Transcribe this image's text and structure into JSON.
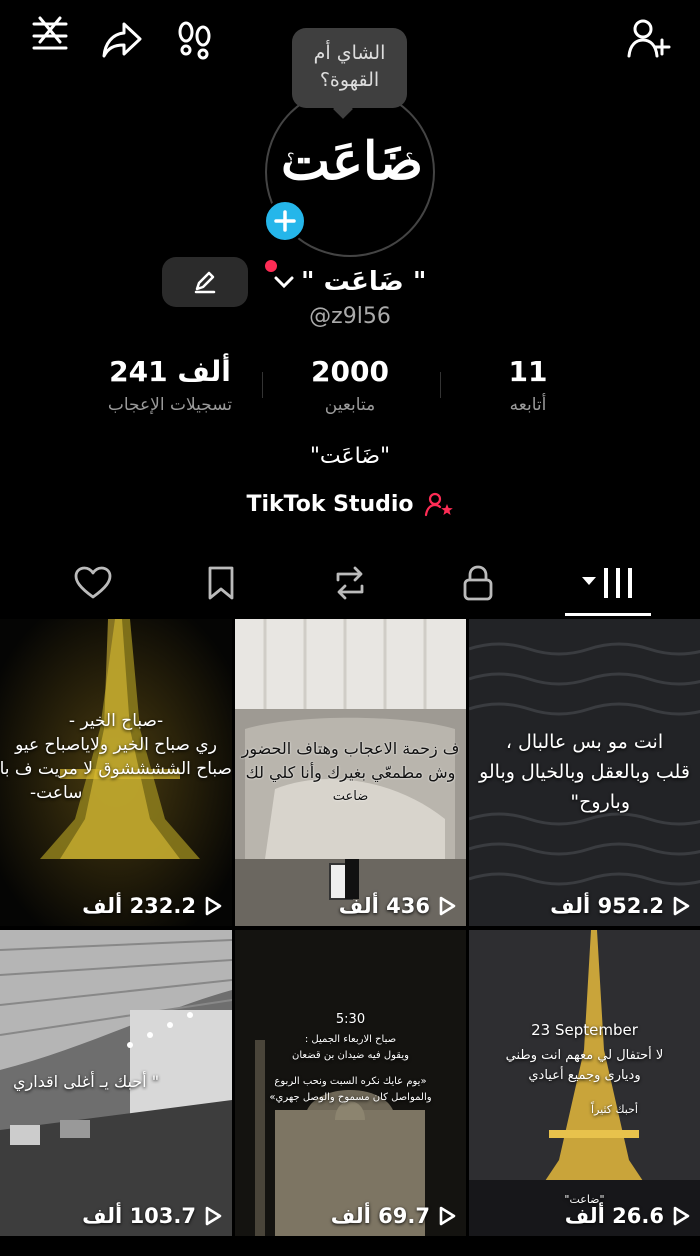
{
  "profile": {
    "note": "الشاي أم القهوة؟",
    "avatar_text": "ضَاعَت",
    "avatar_q": "؟",
    "display_name": "\" ضَاعَت \"",
    "username": "@z9l56",
    "bio": "\"ضَاعَت\"",
    "studio_label": "TikTok Studio"
  },
  "stats": [
    {
      "value": "241 ألف",
      "label": "تسجيلات الإعجاب"
    },
    {
      "value": "2000",
      "label": "متابعين"
    },
    {
      "value": "11",
      "label": "أتابعه"
    }
  ],
  "videos": [
    {
      "lines": [
        "-صباح الخير -",
        "ري صباح الخير ولاياصباح عيو",
        "صباح الششششوق لا مريت ف با",
        "ساعت-"
      ],
      "views": "232.2 ألف"
    },
    {
      "lines": [
        "ف زحمة الاعجاب وهتاف الحضور",
        "وش مطمعّي بغيرك وأنا كلي لك",
        "ضاعت"
      ],
      "views": "436 ألف"
    },
    {
      "lines": [
        "انت مو بس عالبال ،",
        "قلب وبالعقل وبالخيال وبالو",
        "وباروح\""
      ],
      "views": "952.2 ألف"
    },
    {
      "lines": [
        "\" أحبك يـ أغلى اقداري"
      ],
      "views": "103.7 ألف"
    },
    {
      "lines": [
        "5:30",
        "صباح الاربعاء الجميل :",
        "ويقول فيه ضيدان بن قضعان",
        "«يوم عايك نكره السبت ونحب الربوع",
        "والمواصل كان مسموح والوصل جهري»"
      ],
      "views": "69.7 ألف"
    },
    {
      "lines": [
        "23 September",
        "لا أحتفال لي معهم انت وطني",
        "وديارى وجميع أعيادي",
        "أحبك كثيراً",
        "\"ضاعت\""
      ],
      "views": "26.6 ألف"
    }
  ],
  "colors": {
    "accent_blue": "#25b6ea",
    "accent_red": "#fe2c55",
    "bg": "#000000"
  },
  "icons": [
    "close-menu-icon",
    "share-icon",
    "footprints-icon",
    "add-friend-icon",
    "pencil-icon",
    "heart-icon",
    "bookmark-icon",
    "repost-icon",
    "lock-icon",
    "grid-icon",
    "play-icon"
  ]
}
